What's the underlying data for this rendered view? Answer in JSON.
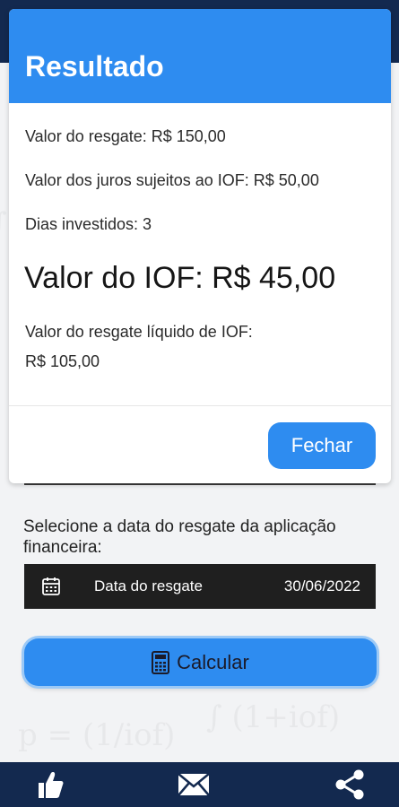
{
  "dialog": {
    "title": "Resultado",
    "lines": [
      "Valor do resgate: R$ 150,00",
      "Valor dos juros sujeitos ao IOF: R$ 50,00",
      "Dias investidos: 3"
    ],
    "iof_text": "Valor do IOF: R$ 45,00",
    "net_label": "Valor do resgate líquido de IOF:",
    "net_value": "R$ 105,00",
    "close_button": "Fechar"
  },
  "form": {
    "prompt": "Selecione a data do resgate da aplicação financeira:",
    "date_label": "Data do resgate",
    "date_value": "30/06/2022",
    "calculate_button": "Calcular"
  },
  "bottom_nav": {
    "icons": [
      "thumbs-up-icon",
      "mail-icon",
      "share-icon"
    ]
  },
  "colors": {
    "primary": "#2e8cf0",
    "navy": "#13294f",
    "date_bar": "#1f1f1f"
  }
}
